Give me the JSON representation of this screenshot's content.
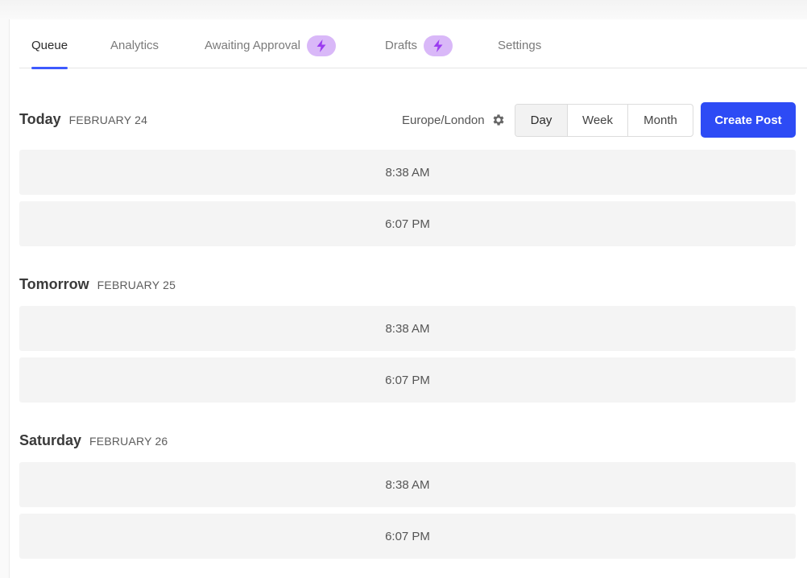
{
  "tabs": [
    {
      "label": "Queue",
      "active": true
    },
    {
      "label": "Analytics"
    },
    {
      "label": "Awaiting Approval",
      "badge_icon": "lightning-bolt-icon"
    },
    {
      "label": "Drafts",
      "badge_icon": "lightning-bolt-icon"
    },
    {
      "label": "Settings"
    }
  ],
  "toolbar": {
    "timezone": "Europe/London",
    "timezone_icon": "gear-icon",
    "views": [
      "Day",
      "Week",
      "Month"
    ],
    "selected_view": "Day",
    "create_label": "Create Post"
  },
  "days": [
    {
      "name": "Today",
      "date": "FEBRUARY 24",
      "slots": [
        "8:38 AM",
        "6:07 PM"
      ]
    },
    {
      "name": "Tomorrow",
      "date": "FEBRUARY 25",
      "slots": [
        "8:38 AM",
        "6:07 PM"
      ]
    },
    {
      "name": "Saturday",
      "date": "FEBRUARY 26",
      "slots": [
        "8:38 AM",
        "6:07 PM"
      ]
    }
  ],
  "colors": {
    "accent": "#2d4bf5",
    "tab_underline": "#3d5afe",
    "badge_bg": "#d9b8f8",
    "badge_icon": "#9b3cf0",
    "slot_bg": "#f4f4f4"
  }
}
